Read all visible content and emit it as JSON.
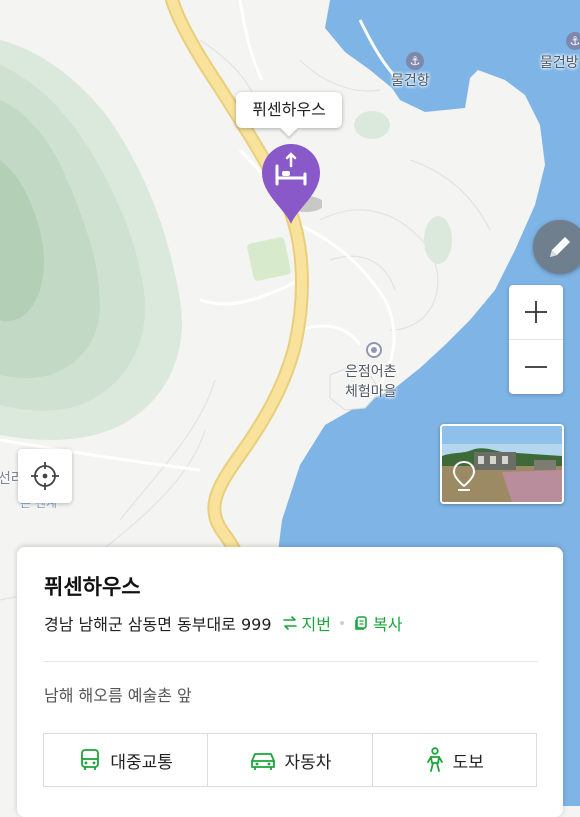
{
  "map": {
    "labels": {
      "port_name": "물건항",
      "port_name_partial": "물건방",
      "village_line1": "은점어촌",
      "village_line2": "체험마을",
      "west_partial": "선라",
      "west_partial2": "은 펜계"
    },
    "marker_label": "퓌센하우스",
    "marker_icon": "bed-icon",
    "colors": {
      "sea": "#7fb5e6",
      "road": "#f6db8c",
      "terrain": "#c6dcc8",
      "marker": "#8a59c9"
    }
  },
  "controls": {
    "edit_icon": "pencil-icon",
    "zoom_in_icon": "plus-icon",
    "zoom_out_icon": "minus-icon",
    "locate_icon": "crosshair-icon"
  },
  "card": {
    "name": "퓌센하우스",
    "address": "경남 남해군 삼동면 동부대로 999",
    "lot_label": "지번",
    "copy_label": "복사",
    "description": "남해 해오름 예술촌 앞",
    "nav": {
      "transit": "대중교통",
      "car": "자동차",
      "walk": "도보"
    }
  }
}
